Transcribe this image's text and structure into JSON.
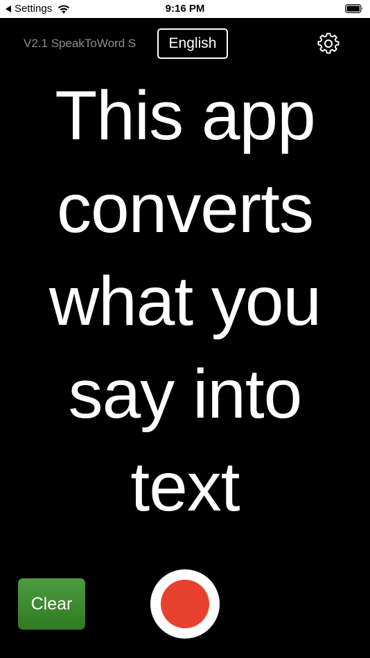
{
  "status_bar": {
    "back_label": "Settings",
    "time": "9:16 PM"
  },
  "header": {
    "version_label": "V2.1 SpeakToWord S",
    "language_button": "English"
  },
  "main": {
    "transcript": "This app converts what you say into text"
  },
  "controls": {
    "clear_label": "Clear"
  },
  "colors": {
    "background": "#000000",
    "record_red": "#e9412f",
    "clear_green": "#3c8a2e",
    "version_gray": "#8e8e93"
  },
  "icons": {
    "back": "back-arrow-icon",
    "wifi": "wifi-icon",
    "battery": "battery-icon",
    "settings": "gear-icon",
    "record": "record-icon"
  }
}
